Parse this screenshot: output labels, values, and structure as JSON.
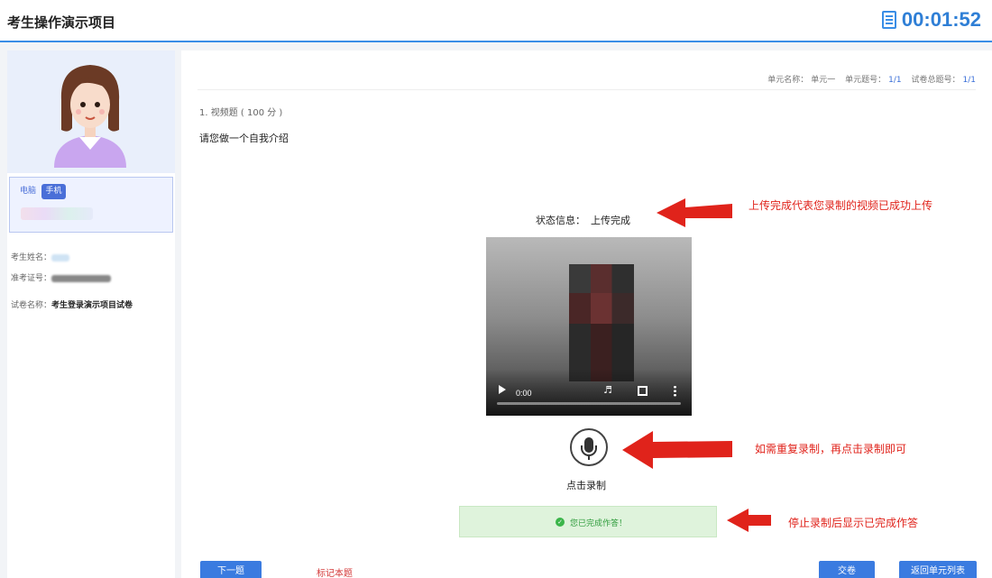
{
  "header": {
    "title": "考生操作演示项目",
    "timer": "00:01:52",
    "timer_icon": "document-timer-icon",
    "accent_color": "#3a8ee6"
  },
  "sidebar": {
    "camera_tabs": [
      "电脑",
      "手机"
    ],
    "active_tab": "手机",
    "candidate_name_label": "考生姓名：",
    "admission_no_label": "准考证号：",
    "paper_name_label": "试卷名称：",
    "paper_name_value": "考生登录演示项目试卷"
  },
  "main": {
    "meta": {
      "unit_name_label": "单元名称：",
      "unit_name_value": "单元一",
      "unit_q_label": "单元题号：",
      "unit_q_value": "1/1",
      "paper_q_label": "试卷总题号：",
      "paper_q_value": "1/1"
    },
    "question_number": "1. 视频题 ( 100 分 )",
    "question_text": "请您做一个自我介绍",
    "status_label": "状态信息：",
    "status_value": "上传完成",
    "video_time": "0:00",
    "record_label": "点击录制",
    "done_message": "您已完成作答！",
    "buttons": {
      "next": "下一题",
      "mark": "标记本题",
      "submit": "交卷",
      "back": "返回单元列表"
    }
  },
  "annotations": {
    "upload": "上传完成代表您录制的视频已成功上传",
    "rerecord": "如需重复录制，再点击录制即可",
    "done": "停止录制后显示已完成作答",
    "color": "#e0231b"
  }
}
